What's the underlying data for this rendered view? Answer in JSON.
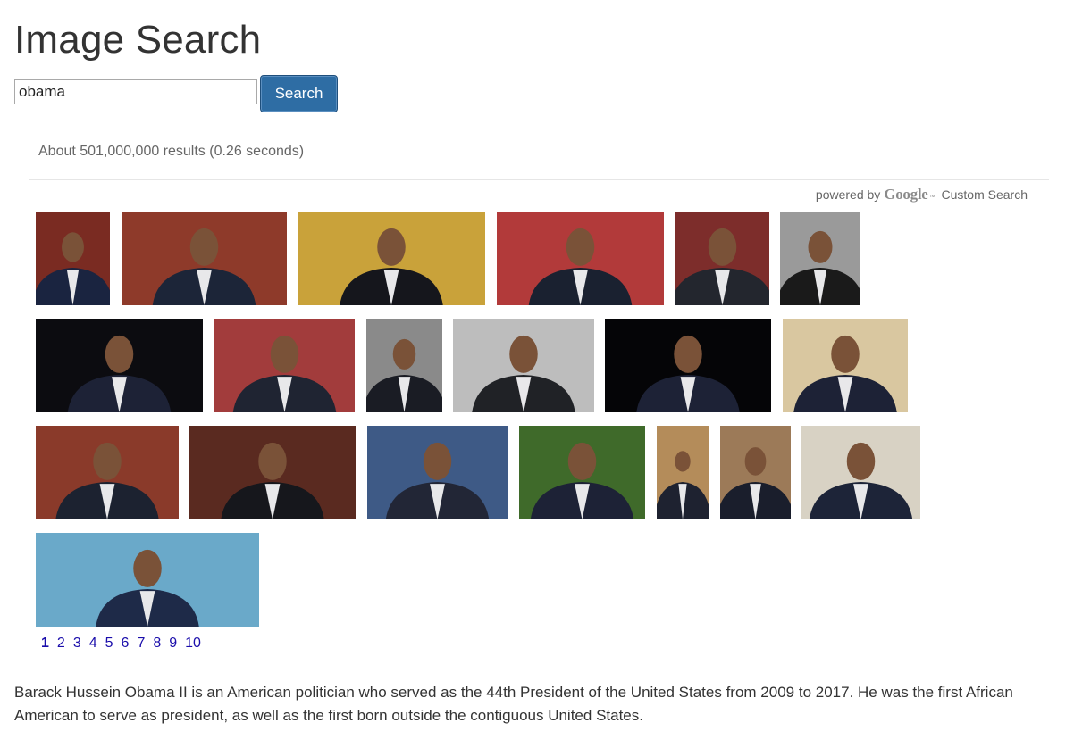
{
  "title": "Image Search",
  "search": {
    "value": "obama",
    "button_label": "Search"
  },
  "results_info": "About 501,000,000 results (0.26 seconds)",
  "branding": {
    "powered_by": "powered by",
    "google": "Google",
    "tm": "™",
    "custom_search": "Custom Search"
  },
  "images": [
    {
      "bg": "#7a2b22",
      "accent": "#1a2440"
    },
    {
      "bg": "#8e3a2a",
      "accent": "#1c2538"
    },
    {
      "bg": "#c9a23a",
      "accent": "#15161c"
    },
    {
      "bg": "#b23a3a",
      "accent": "#1a2130"
    },
    {
      "bg": "#7d2d2b",
      "accent": "#23262e"
    },
    {
      "bg": "#9a9a9a",
      "accent": "#1a1a1a"
    },
    {
      "bg": "#0c0c10",
      "accent": "#1d2236"
    },
    {
      "bg": "#a23c3c",
      "accent": "#1f2432"
    },
    {
      "bg": "#8a8a8a",
      "accent": "#1a1c24"
    },
    {
      "bg": "#bdbdbd",
      "accent": "#202226"
    },
    {
      "bg": "#050507",
      "accent": "#1d2236"
    },
    {
      "bg": "#d9c7a0",
      "accent": "#1d2236"
    },
    {
      "bg": "#8a3a2a",
      "accent": "#1c2230"
    },
    {
      "bg": "#5a2a20",
      "accent": "#16171c"
    },
    {
      "bg": "#3e5a86",
      "accent": "#222636"
    },
    {
      "bg": "#3f6a2a",
      "accent": "#1d2236"
    },
    {
      "bg": "#b48c5a",
      "accent": "#1e2230"
    },
    {
      "bg": "#9c7a58",
      "accent": "#1a1e2c"
    },
    {
      "bg": "#d8d2c4",
      "accent": "#1d2438"
    },
    {
      "bg": "#6aa9c9",
      "accent": "#1e2a48"
    }
  ],
  "pagination": [
    "1",
    "2",
    "3",
    "4",
    "5",
    "6",
    "7",
    "8",
    "9",
    "10"
  ],
  "current_page": "1",
  "description": "Barack Hussein Obama II is an American politician who served as the 44th President of the United States from 2009 to 2017. He was the first African American to serve as president, as well as the first born outside the contiguous United States."
}
